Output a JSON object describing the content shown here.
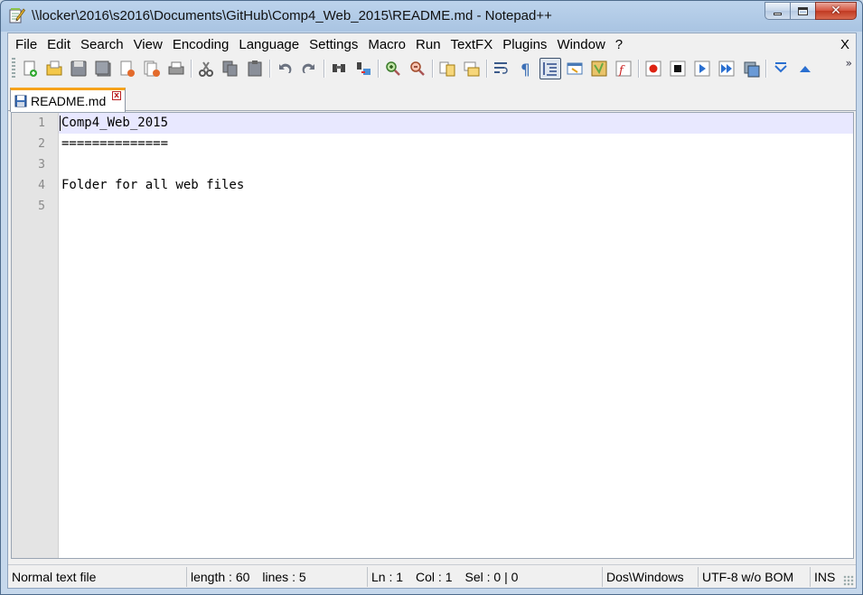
{
  "window": {
    "title": "\\\\locker\\2016\\s2016\\Documents\\GitHub\\Comp4_Web_2015\\README.md - Notepad++"
  },
  "menu": {
    "items": [
      "File",
      "Edit",
      "Search",
      "View",
      "Encoding",
      "Language",
      "Settings",
      "Macro",
      "Run",
      "TextFX",
      "Plugins",
      "Window",
      "?"
    ],
    "close": "X"
  },
  "toolbar": {
    "icons": [
      "new-file",
      "open-file",
      "save",
      "save-all",
      "close",
      "close-all",
      "print",
      "cut",
      "copy",
      "paste",
      "undo",
      "redo",
      "find",
      "replace",
      "zoom-in",
      "zoom-out",
      "sync-vertical",
      "sync-horizontal",
      "word-wrap",
      "show-all-characters",
      "indent-guide",
      "user-defined-language",
      "document-map",
      "function-list",
      "record-macro",
      "stop-recording",
      "play-macro",
      "run-macro-multiple",
      "save-macro",
      "collapse",
      "expand"
    ],
    "active": "indent-guide"
  },
  "tabs": [
    {
      "label": "README.md",
      "close": "x"
    }
  ],
  "editor": {
    "line_numbers": [
      "1",
      "2",
      "3",
      "4",
      "5"
    ],
    "lines": [
      "Comp4_Web_2015",
      "==============",
      "",
      "Folder for all web files",
      ""
    ],
    "current_line_color": "#e8e8ff"
  },
  "status": {
    "file_type": "Normal text file",
    "length": "length : 60",
    "lines": "lines : 5",
    "ln": "Ln : 1",
    "col": "Col : 1",
    "sel": "Sel : 0 | 0",
    "eol": "Dos\\Windows",
    "encoding": "UTF-8 w/o BOM",
    "mode": "INS"
  }
}
